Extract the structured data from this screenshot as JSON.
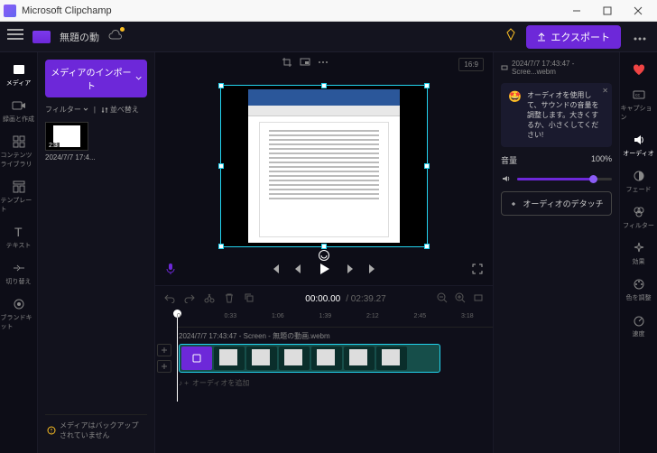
{
  "app": {
    "title": "Microsoft Clipchamp"
  },
  "topbar": {
    "project_name": "無題の動",
    "export_label": "エクスポート"
  },
  "left_rail": {
    "items": [
      {
        "label": "メディア"
      },
      {
        "label": "録画と作成"
      },
      {
        "label": "コンテンツライブラリ"
      },
      {
        "label": "テンプレート"
      },
      {
        "label": "テキスト"
      },
      {
        "label": "切り替え"
      },
      {
        "label": "ブランドキット"
      }
    ]
  },
  "media_panel": {
    "import_label": "メディアのインポート",
    "filter_label": "フィルター",
    "sort_label": "並べ替え",
    "thumb_time": "2:3",
    "thumb_name": "2024/7/7 17:4...",
    "backup_notice": "メディアはバックアップされていません"
  },
  "preview": {
    "aspect": "16:9"
  },
  "playback": {
    "current_time": "00:00.00",
    "duration": "02:39.27"
  },
  "ruler": {
    "ticks": [
      "0",
      "0:33",
      "1:06",
      "1:39",
      "2:12",
      "2:45",
      "3:18"
    ]
  },
  "clip": {
    "label": "2024/7/7 17:43:47 - Screen - 無題の動画.webm"
  },
  "audio_track": {
    "placeholder": "オーディオを追加"
  },
  "right_panel": {
    "clip_name": "2024/7/7 17:43:47 - Scree...webm",
    "tip": "オーディオを使用して、サウンドの音量を調整します。大きくするか、小さくしてください!",
    "volume_label": "音量",
    "volume_value": "100%",
    "detach_label": "オーディオのデタッチ"
  },
  "right_rail": {
    "items": [
      {
        "label": "キャプション"
      },
      {
        "label": "オーディオ"
      },
      {
        "label": "フェード"
      },
      {
        "label": "フィルター"
      },
      {
        "label": "効果"
      },
      {
        "label": "色を調整"
      },
      {
        "label": "速度"
      }
    ]
  }
}
